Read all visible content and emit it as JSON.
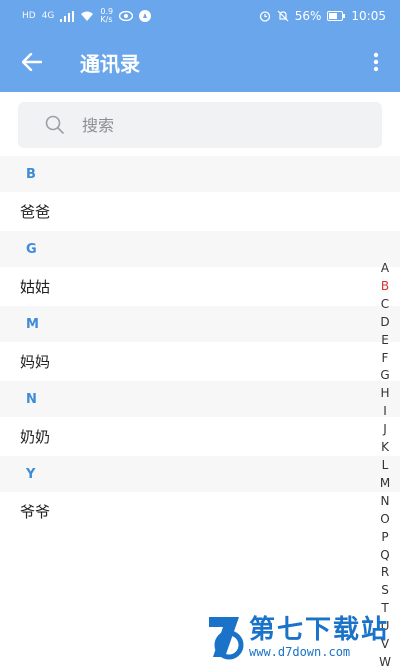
{
  "status_bar": {
    "hd_label": "HD",
    "network_label": "4G",
    "speed_value": "0.9",
    "speed_unit": "K/s",
    "battery": "56%",
    "time": "10:05"
  },
  "app_bar": {
    "title": "通讯录"
  },
  "search": {
    "placeholder": "搜索"
  },
  "contacts": {
    "sections": [
      {
        "letter": "B",
        "name": "爸爸"
      },
      {
        "letter": "G",
        "name": "姑姑"
      },
      {
        "letter": "M",
        "name": "妈妈"
      },
      {
        "letter": "N",
        "name": "奶奶"
      },
      {
        "letter": "Y",
        "name": "爷爷"
      }
    ]
  },
  "index_bar": {
    "letters": [
      "A",
      "B",
      "C",
      "D",
      "E",
      "F",
      "G",
      "H",
      "I",
      "J",
      "K",
      "L",
      "M",
      "N",
      "O",
      "P",
      "Q",
      "R",
      "S",
      "T",
      "U",
      "V",
      "W"
    ],
    "active": "B"
  },
  "watermark": {
    "text": "第七下载站",
    "url": "www.d7down.com"
  },
  "colors": {
    "accent": "#6aa6ec",
    "section_letter": "#3e8bd6",
    "index_active": "#dd3333"
  }
}
